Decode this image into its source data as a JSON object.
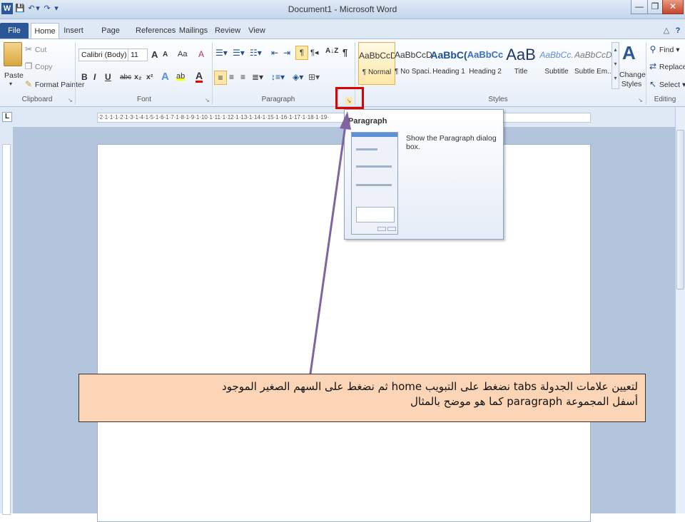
{
  "window": {
    "title": "Document1 - Microsoft Word",
    "minimize": "—",
    "restore": "❐",
    "close": "✕"
  },
  "quick_access": {
    "word_icon": "W",
    "save": "💾",
    "undo": "↶",
    "undo_drop": "▾",
    "redo": "↷",
    "customize": "▾"
  },
  "tabs": [
    "File",
    "Home",
    "Insert",
    "Page Layout",
    "References",
    "Mailings",
    "Review",
    "View"
  ],
  "help_icons": {
    "minimize_ribbon": "△",
    "help": "?"
  },
  "clipboard": {
    "paste": "Paste",
    "cut": "Cut",
    "copy": "Copy",
    "format_painter": "Format Painter",
    "label": "Clipboard"
  },
  "font": {
    "name": "Calibri (Body)",
    "size": "11",
    "grow": "A",
    "shrink": "A",
    "case": "Aa",
    "clear": "A",
    "bold": "B",
    "italic": "I",
    "underline": "U",
    "strike": "abc",
    "subscript": "x₂",
    "superscript": "x²",
    "effects": "A",
    "highlight": "ab",
    "color": "A",
    "label": "Font"
  },
  "paragraph": {
    "label": "Paragraph",
    "pilcrow": "¶",
    "sort": "A↓Z"
  },
  "styles": {
    "items": [
      {
        "preview": "AaBbCcDc",
        "name": "¶ Normal"
      },
      {
        "preview": "AaBbCcDc",
        "name": "¶ No Spaci..."
      },
      {
        "preview": "AaBbC(",
        "name": "Heading 1"
      },
      {
        "preview": "AaBbCc",
        "name": "Heading 2"
      },
      {
        "preview": "AaB",
        "name": "Title"
      },
      {
        "preview": "AaBbCc.",
        "name": "Subtitle"
      },
      {
        "preview": "AaBbCcD(",
        "name": "Subtle Em..."
      }
    ],
    "change": "Change Styles",
    "label": "Styles"
  },
  "editing": {
    "find": "Find",
    "replace": "Replace",
    "select": "Select",
    "label": "Editing"
  },
  "ruler": {
    "marks": "·2·1·1·1·2·1·3·1·4·1·5·1·6·1·7·1·8·1·9·1·10·1·11·1·12·1·13·1·14·1·15·1·16·1·17·1·18·1·19·",
    "tab_selector": "L"
  },
  "tooltip": {
    "title": "Paragraph",
    "description": "Show the Paragraph dialog box."
  },
  "note": {
    "line1": "لتعيين علامات الجدولة tabs نضغط على التبويب home ثم نضغط على السهم الصغير الموجود",
    "line2": "أسفل المجموعة paragraph كما هو موضح بالمثال"
  },
  "colors": {
    "accent": "#2b5797",
    "highlight": "#e00000",
    "arrow": "#8064a2",
    "note_bg": "#fbd5b5"
  }
}
